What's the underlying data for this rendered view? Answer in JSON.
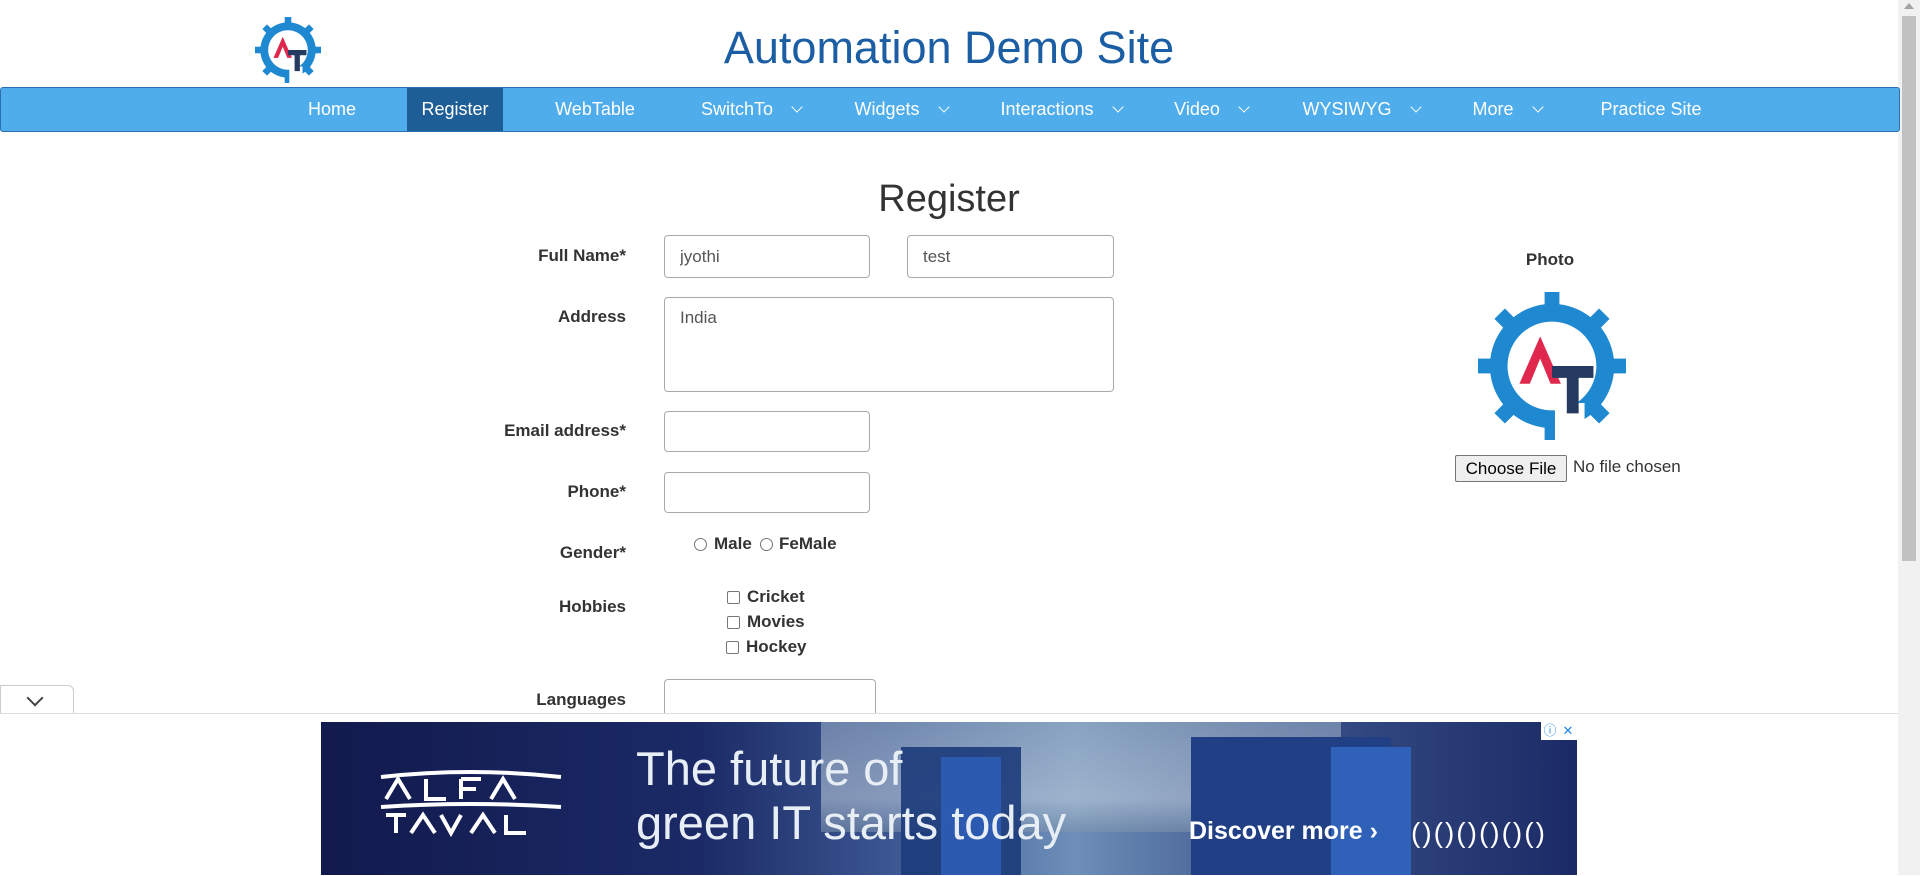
{
  "site": {
    "title": "Automation Demo Site"
  },
  "nav": {
    "items": [
      {
        "label": "Home"
      },
      {
        "label": "Register"
      },
      {
        "label": "WebTable"
      },
      {
        "label": "SwitchTo"
      },
      {
        "label": "Widgets"
      },
      {
        "label": "Interactions"
      },
      {
        "label": "Video"
      },
      {
        "label": "WYSIWYG"
      },
      {
        "label": "More"
      },
      {
        "label": "Practice Site"
      }
    ],
    "active": "Register"
  },
  "form": {
    "heading": "Register",
    "full_name_label": "Full Name*",
    "first_name_value": "jyothi",
    "last_name_value": "test",
    "address_label": "Address",
    "address_value": "India",
    "email_label": "Email address*",
    "email_value": "",
    "phone_label": "Phone*",
    "phone_value": "",
    "gender_label": "Gender*",
    "gender_options": [
      "Male",
      "FeMale"
    ],
    "hobbies_label": "Hobbies",
    "hobbies": [
      "Cricket",
      "Movies",
      "Hockey"
    ],
    "languages_label": "Languages"
  },
  "photo": {
    "label": "Photo",
    "choose_file": "Choose File",
    "file_status": "No file chosen"
  },
  "ad": {
    "brand": "ALFA LAVAL",
    "headline_line1": "The future of",
    "headline_line2": "green IT starts today",
    "cta": "Discover more ›",
    "info_icon": "ⓘ",
    "close_icon": "✕"
  },
  "colors": {
    "nav_bg": "#4eadea",
    "nav_active": "#1e5e97",
    "title": "#1b5ea3"
  }
}
